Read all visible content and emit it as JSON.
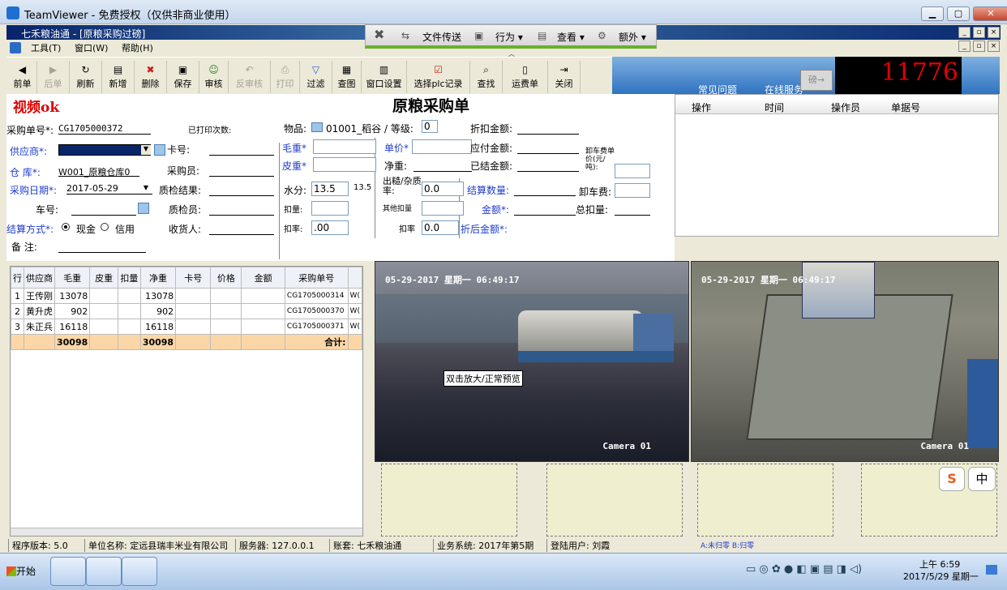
{
  "window_title": "TeamViewer - 免费授权（仅供非商业使用）",
  "app_title": "七禾粮油通 - [原粮采购过磅]",
  "menu": [
    "工具(T)",
    "窗口(W)",
    "帮助(H)"
  ],
  "tv_toolbar": {
    "file": "文件传送",
    "action": "行为 ▾",
    "view": "查看 ▾",
    "extra": "额外 ▾"
  },
  "toolbar": [
    {
      "label": "前单",
      "icon": "prev-icon"
    },
    {
      "label": "后单",
      "icon": "next-icon"
    },
    {
      "label": "刷新",
      "icon": "refresh-icon"
    },
    {
      "label": "新增",
      "icon": "new-icon"
    },
    {
      "label": "删除",
      "icon": "delete-icon"
    },
    {
      "label": "保存",
      "icon": "save-icon"
    },
    {
      "label": "审核",
      "icon": "approve-icon"
    },
    {
      "label": "反审核",
      "icon": "unapprove-icon"
    },
    {
      "label": "打印",
      "icon": "print-icon"
    },
    {
      "label": "过滤",
      "icon": "filter-icon"
    },
    {
      "label": "查图",
      "icon": "image-icon"
    },
    {
      "label": "窗口设置",
      "icon": "window-settings-icon"
    },
    {
      "label": "选择plc记录",
      "icon": "plc-icon"
    },
    {
      "label": "查找",
      "icon": "find-icon"
    },
    {
      "label": "运费单",
      "icon": "freight-icon"
    },
    {
      "label": "关闭",
      "icon": "close-icon"
    }
  ],
  "banner": {
    "faq": "常见问题",
    "online": "在线服务",
    "weigh": "磅→"
  },
  "counter": "11776",
  "form": {
    "video_status": "视频ok",
    "title": "原粮采购单",
    "order_no_label": "采购单号*:",
    "order_no": "CG1705000372",
    "printed_label": "已打印次数:",
    "supplier_label": "供应商*:",
    "card_label": "卡号:",
    "warehouse_label": "仓 库*:",
    "warehouse": "W001_原粮仓库0",
    "buyer_label": "采购员:",
    "date_label": "采购日期*:",
    "date": "2017-05-29",
    "qc_label": "质检结果:",
    "plate_label": "车号:",
    "inspector_label": "质检员:",
    "settle_label": "结算方式*:",
    "cash": "现金",
    "credit": "信用",
    "receiver_label": "收货人:",
    "remark_label": "备 注:",
    "item_label": "物品:",
    "item": "01001_稻谷",
    "grade_label": "/ 等级:",
    "grade": "0",
    "gross_label": "毛重*",
    "tare_label": "皮重*",
    "moisture_label": "水分:",
    "moisture": "13.5",
    "moisture2": "13.5",
    "deduct_label": "扣量:",
    "deduct_rate_label": "扣率:",
    "deduct_rate": ".00",
    "price_label": "单价*",
    "net_label": "净重:",
    "impurity_label": "出糙/杂质率:",
    "impurity": "0.0",
    "other_deduct_label": "其他扣量",
    "rate2_label": "扣率",
    "rate2": "0.0",
    "discount_label": "折扣金额:",
    "payable_label": "应付金额:",
    "settled_label": "已结金额:",
    "settle_qty_label": "结算数量:",
    "amount_label": "金额*:",
    "after_discount_label": "折后金额*:",
    "unload_price_label": "卸车费单价(元/吨):",
    "unload_fee_label": "卸车费:",
    "total_deduct_label": "总扣量:"
  },
  "log_columns": [
    "操作",
    "时间",
    "操作员",
    "单据号"
  ],
  "grid": {
    "columns": [
      "行",
      "供应商",
      "毛重",
      "皮重",
      "扣量",
      "净重",
      "卡号",
      "价格",
      "金额",
      "采购单号",
      ""
    ],
    "rows": [
      [
        "1",
        "王传刚",
        "13078",
        "",
        "",
        "13078",
        "",
        "",
        "",
        "CG1705000314",
        "W("
      ],
      [
        "2",
        "黄升虎",
        "902",
        "",
        "",
        "902",
        "",
        "",
        "",
        "CG1705000370",
        "W("
      ],
      [
        "3",
        "朱正兵",
        "16118",
        "",
        "",
        "16118",
        "",
        "",
        "",
        "CG1705000371",
        "W("
      ]
    ],
    "total": {
      "gross": "30098",
      "net": "30098",
      "label": "合计:"
    }
  },
  "camera1": {
    "timestamp": "05-29-2017 星期一 06:49:17",
    "label": "Camera 01",
    "tooltip": "双击放大/正常预览"
  },
  "camera2": {
    "timestamp": "05-29-2017 星期一 06:49:17",
    "label": "Camera 01"
  },
  "ime": {
    "s": "S",
    "zh": "中"
  },
  "status": [
    "程序版本: 5.0",
    "单位名称: 定远县瑞丰米业有限公司",
    "服务器: 127.0.0.1",
    "账套: 七禾粮油通",
    "业务系统: 2017年第5期",
    "登陆用户: 刘霞",
    "A:未归零  B:归零"
  ],
  "taskbar": {
    "start": "开始",
    "time": "上午 6:59",
    "date": "2017/5/29 星期一"
  }
}
